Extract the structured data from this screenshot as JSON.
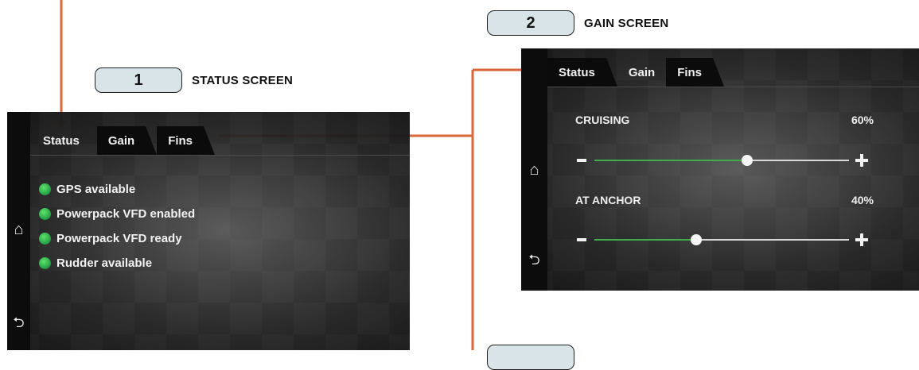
{
  "callouts": [
    {
      "number": "1",
      "label": "STATUS SCREEN"
    },
    {
      "number": "2",
      "label": "GAIN SCREEN"
    }
  ],
  "tabs": [
    "Status",
    "Gain",
    "Fins"
  ],
  "status_screen": {
    "active_tab": "Status",
    "items": [
      {
        "label": "GPS available",
        "state": "green"
      },
      {
        "label": "Powerpack VFD enabled",
        "state": "green"
      },
      {
        "label": "Powerpack VFD ready",
        "state": "green"
      },
      {
        "label": "Rudder available",
        "state": "green"
      }
    ]
  },
  "gain_screen": {
    "active_tab": "Gain",
    "tab_labels": [
      "Status",
      "Gain",
      "Fins"
    ],
    "sliders": [
      {
        "label": "CRUISING",
        "value_text": "60%",
        "value": 0.6
      },
      {
        "label": "AT ANCHOR",
        "value_text": "40%",
        "value": 0.4
      }
    ]
  },
  "icons": {
    "home": "home-icon",
    "back": "back-icon"
  },
  "colors": {
    "callout_fill": "#d9e4e8",
    "connector": "#d8673a",
    "status_led": "#2aa84a",
    "slider_fill": "#3fae4a"
  }
}
